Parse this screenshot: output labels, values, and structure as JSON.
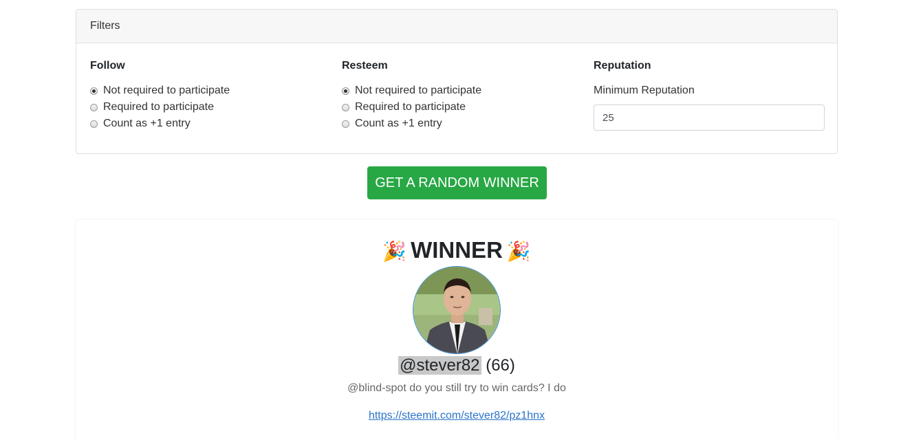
{
  "filters": {
    "header": "Filters",
    "follow": {
      "title": "Follow",
      "options": [
        {
          "label": "Not required to participate",
          "checked": true
        },
        {
          "label": "Required to participate",
          "checked": false
        },
        {
          "label": "Count as +1 entry",
          "checked": false
        }
      ]
    },
    "resteem": {
      "title": "Resteem",
      "options": [
        {
          "label": "Not required to participate",
          "checked": true
        },
        {
          "label": "Required to participate",
          "checked": false
        },
        {
          "label": "Count as +1 entry",
          "checked": false
        }
      ]
    },
    "reputation": {
      "title": "Reputation",
      "label": "Minimum Reputation",
      "value": "25"
    }
  },
  "action": {
    "button_label": "GET A RANDOM WINNER",
    "button_color": "#28a745"
  },
  "winner": {
    "title": "WINNER",
    "left_icon": "party-popper-icon",
    "right_icon": "party-popper-icon",
    "username": "@stever82",
    "reputation": "(66)",
    "comment": "@blind-spot do you still try to win cards? I do",
    "link": "https://steemit.com/stever82/pz1hnx"
  }
}
